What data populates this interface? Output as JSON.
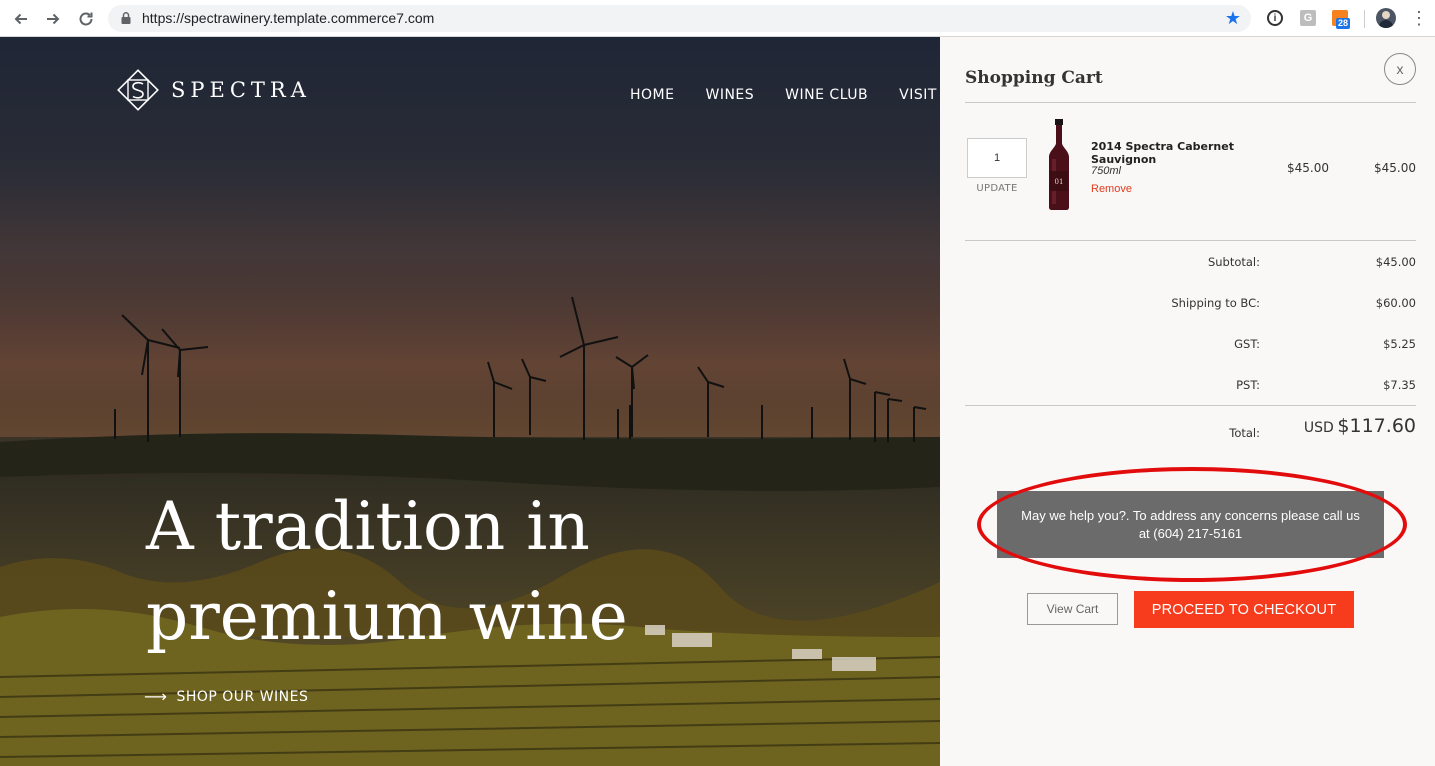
{
  "browser": {
    "url": "https://spectrawinery.template.commerce7.com",
    "extension_badge": "28",
    "extension_g_label": "G"
  },
  "site": {
    "brand": "SPECTRA",
    "nav": [
      "HOME",
      "WINES",
      "WINE CLUB",
      "VISIT"
    ],
    "hero_title": "A tradition in premium wine",
    "cta": "SHOP OUR WINES"
  },
  "cart": {
    "title": "Shopping Cart",
    "close_label": "x",
    "item": {
      "quantity": "1",
      "update_label": "UPDATE",
      "name": "2014 Spectra Cabernet Sauvignon",
      "size": "750ml",
      "remove_label": "Remove",
      "unit_price": "$45.00",
      "line_total": "$45.00",
      "bottle_label": "01"
    },
    "summary": [
      {
        "label": "Subtotal:",
        "value": "$45.00"
      },
      {
        "label": "Shipping to BC:",
        "value": "$60.00"
      },
      {
        "label": "GST:",
        "value": "$5.25"
      },
      {
        "label": "PST:",
        "value": "$7.35"
      }
    ],
    "total": {
      "label": "Total:",
      "currency": "USD",
      "amount": "$117.60"
    },
    "help_message": "May we help you?. To address any concerns please call us at (604) 217-5161",
    "view_cart_label": "View Cart",
    "checkout_label": "PROCEED TO CHECKOUT"
  },
  "colors": {
    "checkout": "#f63c1d",
    "remove_link": "#e03c1f",
    "annotation_ring": "#e20c0c",
    "help_bg": "#6b6b6b",
    "omnibox_star": "#1a73e8"
  }
}
